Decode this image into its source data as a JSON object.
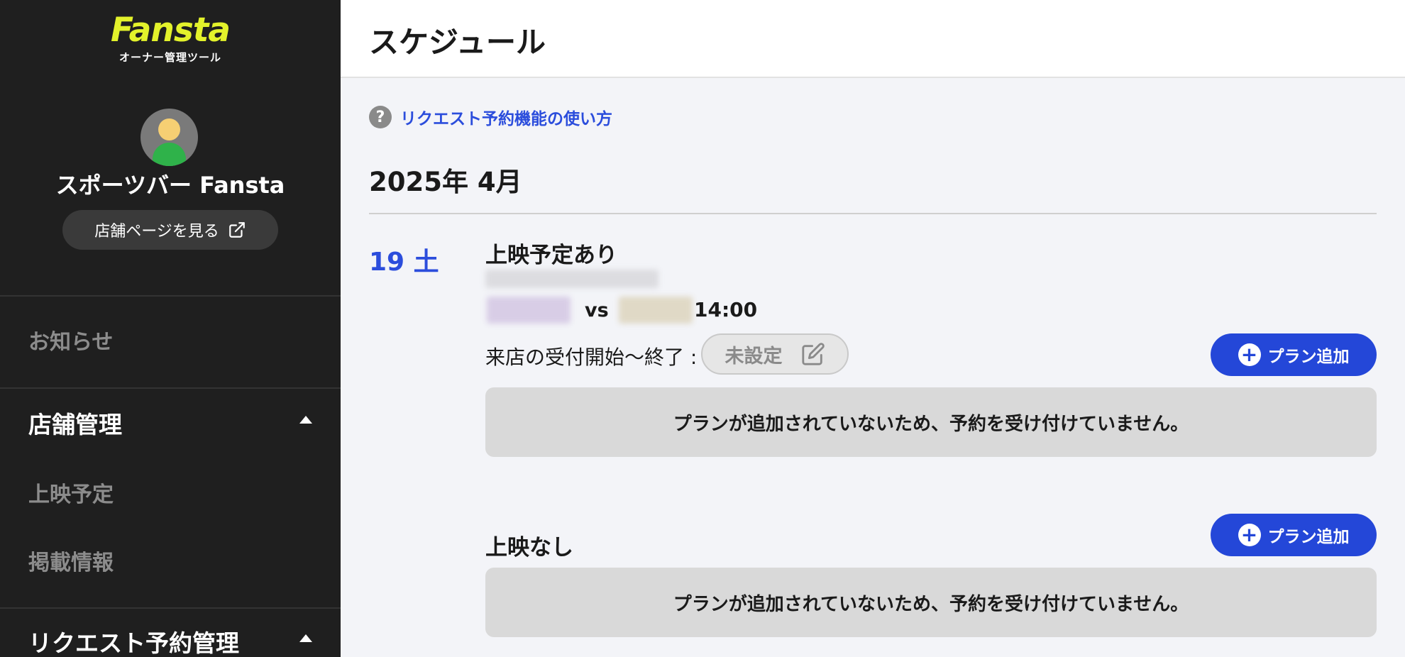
{
  "brand": {
    "logo_text": "Fansta",
    "subtitle": "オーナー管理ツール",
    "logo_color": "#e3f22b"
  },
  "sidebar": {
    "shop_name": "スポーツバー Fansta",
    "shop_link_label": "店舗ページを見る",
    "items": [
      {
        "label": "お知らせ",
        "type": "item"
      },
      {
        "label": "店舗管理",
        "type": "section",
        "expanded": true
      },
      {
        "label": "上映予定",
        "type": "subitem"
      },
      {
        "label": "掲載情報",
        "type": "subitem"
      },
      {
        "label": "リクエスト予約管理",
        "type": "section",
        "expanded": true
      }
    ],
    "background": "#1f1f1f"
  },
  "header": {
    "title": "スケジュール"
  },
  "main": {
    "help_label": "リクエスト予約機能の使い方",
    "month": "2025年 4月",
    "day": {
      "label": "19 土",
      "blocks": [
        {
          "title": "上映予定あり",
          "match": {
            "vs": "vs",
            "time": "14:00"
          },
          "reception_label": "来店の受付開始〜終了 :",
          "reception_value": "未設定",
          "add_plan_label": "プラン追加",
          "empty_message": "プランが追加されていないため、予約を受け付けていません。"
        },
        {
          "title": "上映なし",
          "add_plan_label": "プラン追加",
          "empty_message": "プランが追加されていないため、予約を受け付けていません。"
        }
      ]
    },
    "accent_color": "#2447d8"
  }
}
